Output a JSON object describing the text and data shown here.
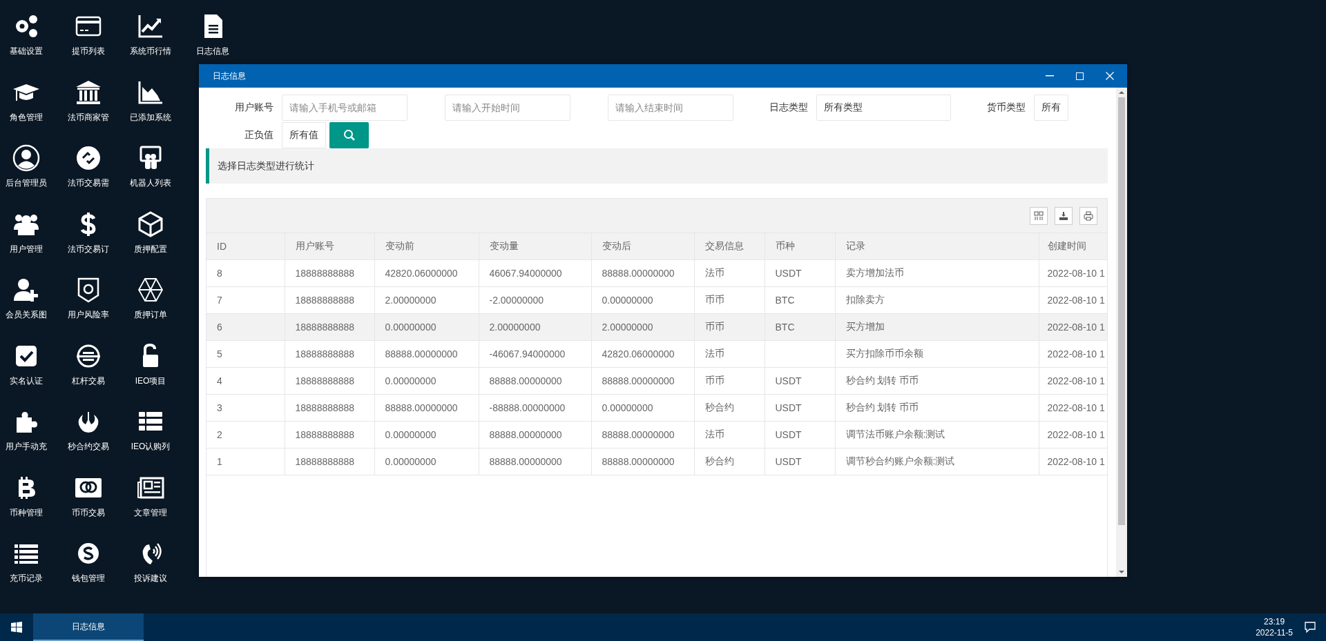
{
  "desktop": {
    "icons": [
      {
        "label": "基础设置"
      },
      {
        "label": "角色管理"
      },
      {
        "label": "后台管理员"
      },
      {
        "label": "用户管理"
      },
      {
        "label": "会员关系图"
      },
      {
        "label": "实名认证"
      },
      {
        "label": "用户手动充"
      },
      {
        "label": "币种管理"
      },
      {
        "label": "充币记录"
      },
      {
        "label": "提币列表"
      },
      {
        "label": "法币商家管"
      },
      {
        "label": "法币交易需"
      },
      {
        "label": "法币交易订"
      },
      {
        "label": "用户风险率"
      },
      {
        "label": "杠杆交易"
      },
      {
        "label": "秒合约交易"
      },
      {
        "label": "币币交易"
      },
      {
        "label": "钱包管理"
      },
      {
        "label": "系统币行情"
      },
      {
        "label": "已添加系统"
      },
      {
        "label": "机器人列表"
      },
      {
        "label": "质押配置"
      },
      {
        "label": "质押订单"
      },
      {
        "label": "IEO项目"
      },
      {
        "label": "IEO认购列"
      },
      {
        "label": "文章管理"
      },
      {
        "label": "投诉建议"
      },
      {
        "label": "日志信息"
      }
    ]
  },
  "window": {
    "title": "日志信息"
  },
  "filter_rows": [
    [
      {
        "kind": "input",
        "label": "用户账号",
        "placeholder": "请输入手机号或邮箱"
      },
      {
        "kind": "input",
        "placeholder": "请输入开始时间"
      },
      {
        "kind": "input",
        "placeholder": "请输入结束时间"
      },
      {
        "kind": "select",
        "label": "日志类型",
        "value": "所有类型"
      },
      {
        "kind": "select",
        "label": "货币类型",
        "value": "所有"
      }
    ],
    [
      {
        "kind": "select",
        "label": "正负值",
        "value": "所有值"
      },
      {
        "kind": "search"
      }
    ]
  ],
  "notice": "选择日志类型进行统计",
  "table": {
    "columns": [
      "ID",
      "用户账号",
      "变动前",
      "变动量",
      "变动后",
      "交易信息",
      "币种",
      "记录",
      "创建时间"
    ],
    "rows": [
      {
        "selected": false,
        "cells": [
          "8",
          "18888888888",
          "42820.06000000",
          "46067.94000000",
          "88888.00000000",
          "法币",
          "USDT",
          "卖方增加法币",
          "2022-08-10 1"
        ]
      },
      {
        "selected": false,
        "cells": [
          "7",
          "18888888888",
          "2.00000000",
          "-2.00000000",
          "0.00000000",
          "币币",
          "BTC",
          "扣除卖方",
          "2022-08-10 1"
        ]
      },
      {
        "selected": true,
        "cells": [
          "6",
          "18888888888",
          "0.00000000",
          "2.00000000",
          "2.00000000",
          "币币",
          "BTC",
          "买方增加",
          "2022-08-10 1"
        ]
      },
      {
        "selected": false,
        "cells": [
          "5",
          "18888888888",
          "88888.00000000",
          "-46067.94000000",
          "42820.06000000",
          "法币",
          "",
          "买方扣除币币余额",
          "2022-08-10 1"
        ]
      },
      {
        "selected": false,
        "cells": [
          "4",
          "18888888888",
          "0.00000000",
          "88888.00000000",
          "88888.00000000",
          "币币",
          "USDT",
          "秒合约 划转 币币",
          "2022-08-10 1"
        ]
      },
      {
        "selected": false,
        "cells": [
          "3",
          "18888888888",
          "88888.00000000",
          "-88888.00000000",
          "0.00000000",
          "秒合约",
          "USDT",
          "秒合约 划转 币币",
          "2022-08-10 1"
        ]
      },
      {
        "selected": false,
        "cells": [
          "2",
          "18888888888",
          "0.00000000",
          "88888.00000000",
          "88888.00000000",
          "法币",
          "USDT",
          "调节法币账户余额:测试",
          "2022-08-10 1"
        ]
      },
      {
        "selected": false,
        "cells": [
          "1",
          "18888888888",
          "0.00000000",
          "88888.00000000",
          "88888.00000000",
          "秒合约",
          "USDT",
          "调节秒合约账户余额:测试",
          "2022-08-10 1"
        ]
      }
    ]
  },
  "taskbar": {
    "tasks": [
      {
        "label": "日志信息",
        "selected": true
      }
    ],
    "time": "23:19",
    "date": "2022-11-5"
  }
}
